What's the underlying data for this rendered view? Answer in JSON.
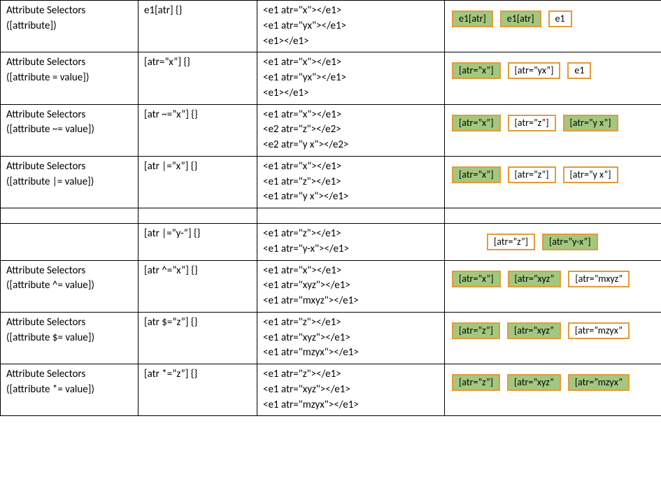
{
  "rows": [
    {
      "id": "r1",
      "title_1": "Attribute Selectors",
      "title_2": "([attribute])",
      "selector": "e1[atr] {}",
      "html": [
        "<e1 atr=\"x\"></e1>",
        "<e1 atr=\"yx\"></e1>",
        "<e1></e1>"
      ],
      "tags": [
        {
          "label": "e1[atr]",
          "match": true
        },
        {
          "label": "e1[atr]",
          "match": true
        },
        {
          "label": "e1",
          "match": false
        }
      ]
    },
    {
      "id": "r2",
      "title_1": "Attribute Selectors",
      "title_2": "([attribute = value])",
      "selector": "[atr=\"x\"] {}",
      "html": [
        "<e1 atr=\"x\"></e1>",
        "<e1 atr=\"yx\"></e1>",
        "<e1></e1>"
      ],
      "tags": [
        {
          "label": "[atr=\"x\"]",
          "match": true
        },
        {
          "label": "[atr=\"yx\"]",
          "match": false
        },
        {
          "label": "e1",
          "match": false
        }
      ]
    },
    {
      "id": "r3",
      "title_1": "Attribute Selectors",
      "title_2": "([attribute ~= value])",
      "selector": "[atr ~=\"x\"] {}",
      "html": [
        "<e1 atr=\"x\"></e1>",
        "<e2 atr=\"z\"></e2>",
        "<e2 atr=\"y x\"></e2>"
      ],
      "tags": [
        {
          "label": "[atr=\"x\"]",
          "match": true
        },
        {
          "label": "[atr=\"z\"]",
          "match": false
        },
        {
          "label": "[atr=\"y x\"]",
          "match": true
        }
      ]
    },
    {
      "id": "r4",
      "title_1": "Attribute Selectors",
      "title_2": "([attribute |= value])",
      "selector": "[atr |=\"x\"] {}",
      "html": [
        "<e1 atr=\"x\"></e1>",
        "<e1 atr=\"z\"></e1>",
        "<e1 atr=\"y x\"></e1>"
      ],
      "tags": [
        {
          "label": "[atr=\"x\"]",
          "match": true
        },
        {
          "label": "[atr=\"z\"]",
          "match": false
        },
        {
          "label": "[atr=\"y x\"]",
          "match": false
        }
      ]
    },
    {
      "id": "r5",
      "title_1": "",
      "title_2": "",
      "selector": "[atr |=\"y-\"] {}",
      "html": [
        "<e1 atr=\"z\"></e1>",
        "<e1 atr=\"y-x\"></e1>"
      ],
      "tags": [
        {
          "label": "[atr=\"z\"]",
          "match": false
        },
        {
          "label": "[atr=\"y-x\"]",
          "match": true
        }
      ],
      "vis_indent": true
    },
    {
      "id": "r6",
      "title_1": "Attribute Selectors",
      "title_2": "([attribute ^= value])",
      "selector": "[atr ^=\"x\"] {}",
      "html": [
        "<e1 atr=\"x\"></e1>",
        "<e1 atr=\"xyz\"></e1>",
        "<e1 atr=\"mxyz\"></e1>"
      ],
      "tags": [
        {
          "label": "[atr=\"x\"]",
          "match": true
        },
        {
          "label": "[atr=\"xyz\"",
          "match": true
        },
        {
          "label": "[atr=\"mxyz\"",
          "match": false
        }
      ]
    },
    {
      "id": "r7",
      "title_1": "Attribute Selectors",
      "title_2": "([attribute $= value])",
      "selector": "[atr $=\"z\"] {}",
      "html": [
        "<e1 atr=\"z\"></e1>",
        "<e1 atr=\"xyz\"></e1>",
        "<e1 atr=\"mzyx\"></e1>"
      ],
      "tags": [
        {
          "label": "[atr=\"z\"]",
          "match": true
        },
        {
          "label": "[atr=\"xyz\"",
          "match": true
        },
        {
          "label": "[atr=\"mzyx\"",
          "match": false
        }
      ]
    },
    {
      "id": "r8",
      "title_1": "Attribute Selectors",
      "title_2": "([attribute *= value])",
      "selector": "[atr *=\"z\"] {}",
      "html": [
        "<e1 atr=\"z\"></e1>",
        "<e1 atr=\"xyz\"></e1>",
        "<e1 atr=\"mzyx\"></e1>"
      ],
      "tags": [
        {
          "label": "[atr=\"z\"]",
          "match": true
        },
        {
          "label": "[atr=\"xyz\"",
          "match": true
        },
        {
          "label": "[atr=\"mzyx\"",
          "match": true
        }
      ]
    }
  ]
}
